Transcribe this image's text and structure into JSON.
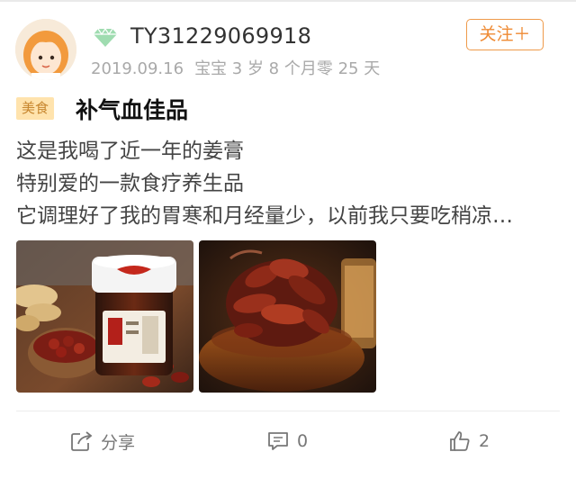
{
  "post": {
    "author": {
      "username": "TY31229069918",
      "avatar_icon": "cartoon-girl-avatar",
      "level_badge_icon": "green-diamond-icon",
      "date": "2019.09.16",
      "baby_age": "宝宝 3 岁 8 个月零 25 天"
    },
    "follow_label": "关注＋",
    "category_tag": "美食",
    "title": "补气血佳品",
    "body_lines": [
      "这是我喝了近一年的姜膏",
      "特别爱的一款食疗养生品",
      "它调理好了我的胃寒和月经量少，以前我只要吃稍凉…"
    ],
    "images": [
      {
        "description_icon": "ginger-paste-jar-photo"
      },
      {
        "description_icon": "jujube-spoon-photo"
      }
    ],
    "actions": {
      "share_label": "分享",
      "comment_count": "0",
      "like_count": "2"
    },
    "colors": {
      "accent": "#ef8a33",
      "tag_bg": "#ffe3ad",
      "tag_text": "#c7862e",
      "meta_text": "#a9a9a9"
    }
  }
}
